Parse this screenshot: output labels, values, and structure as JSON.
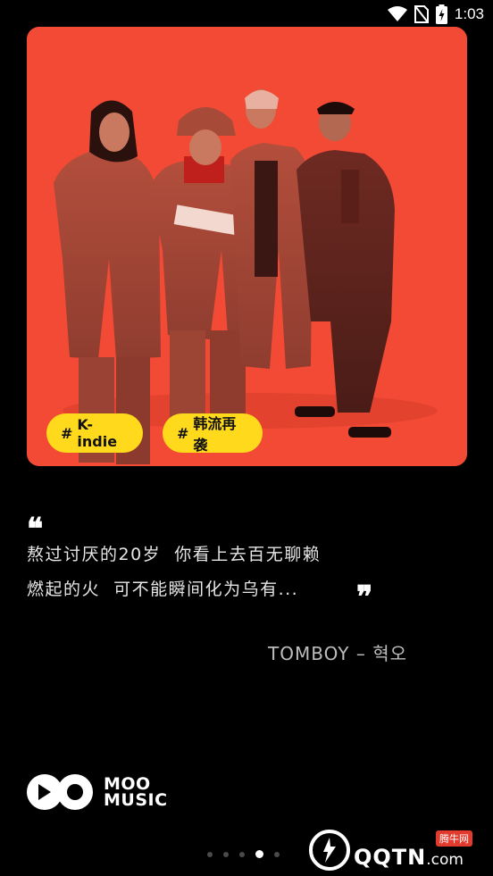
{
  "status_bar": {
    "time": "1:03",
    "icons": [
      "wifi-icon",
      "no-sim-icon",
      "battery-charging-icon"
    ]
  },
  "hero": {
    "image": "band-photo-four-members-red-tint",
    "tags": [
      {
        "hash": "#",
        "label": "K-indie"
      },
      {
        "hash": "#",
        "label": "韩流再袭"
      }
    ]
  },
  "quote": {
    "open_mark": "❝",
    "close_mark": "❞",
    "line1": "熬过讨厌的20岁  你看上去百无聊赖",
    "line2": "燃起的火  可不能瞬间化为乌有...",
    "attribution": "TOMBOY – 혁오"
  },
  "brand": {
    "line1": "MOO",
    "line2": "MUSIC"
  },
  "pager": {
    "count": 5,
    "active_index": 3
  },
  "watermark": {
    "badge": "腾牛网",
    "text": "QQTN",
    "suffix": ".com"
  },
  "colors": {
    "background": "#000000",
    "hero_red": "#f24a34",
    "tag_yellow": "#ffd91c"
  }
}
